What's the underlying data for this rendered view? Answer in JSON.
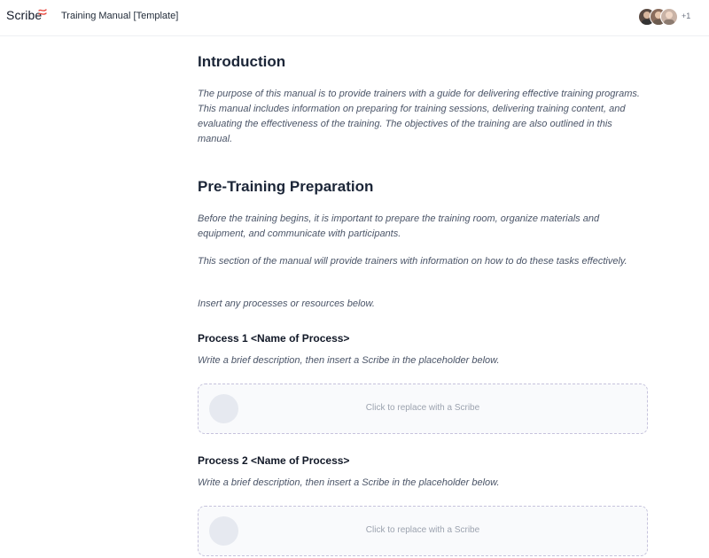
{
  "app": {
    "logo_text": "Scribe",
    "doc_title": "Training Manual [Template]",
    "brand_color": "#e8453c",
    "extra_users": "+1",
    "avatars": [
      "avatar-user-1",
      "avatar-user-2",
      "avatar-user-3"
    ]
  },
  "sections": [
    {
      "heading": "Introduction",
      "paragraphs": [
        "The purpose of this manual is to provide trainers with a guide for delivering effective training programs. This manual includes information on preparing for training sessions, delivering training content, and evaluating the effectiveness of the training. The objectives of the training are also outlined in this manual."
      ]
    },
    {
      "heading": "Pre-Training Preparation",
      "paragraphs": [
        "Before the training begins, it is important to prepare the training room, organize materials and equipment, and communicate with participants.",
        "This section of the manual will provide trainers with information on how to do these tasks effectively.",
        "Insert any processes or resources below."
      ]
    }
  ],
  "processes": [
    {
      "heading": "Process 1 <Name of Process>",
      "description": "Write a brief description, then insert a Scribe in the placeholder below.",
      "placeholder": "Click to replace with a Scribe"
    },
    {
      "heading": "Process 2 <Name of Process>",
      "description": "Write a brief description, then insert a Scribe in the placeholder below.",
      "placeholder": "Click to replace with a Scribe"
    }
  ]
}
